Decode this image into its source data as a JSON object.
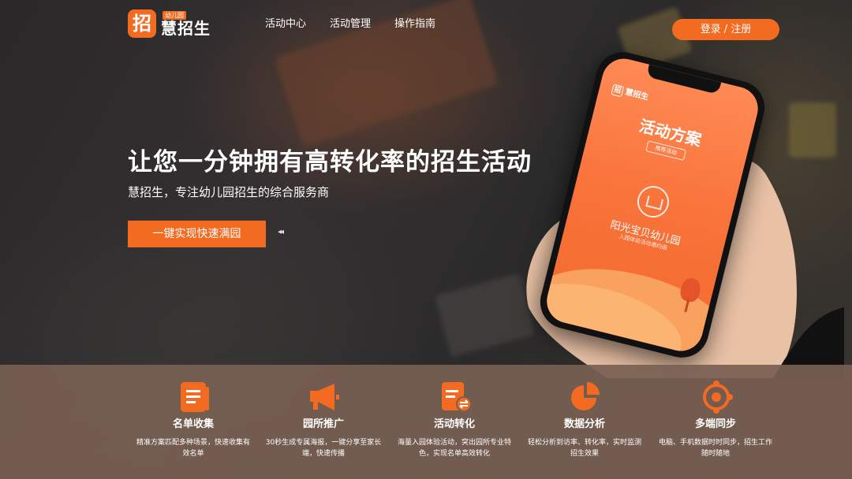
{
  "header": {
    "logo_mark": "招",
    "logo_sub": "幼儿园",
    "logo_text": "慧招生",
    "nav": [
      "活动中心",
      "活动管理",
      "操作指南"
    ],
    "login": "登录 / 注册"
  },
  "hero": {
    "headline": "让您一分钟拥有高转化率的招生活动",
    "subline": "慧招生，专注幼儿园招生的综合服务商",
    "cta": "一键实现快速满园",
    "arrows": "◂◂"
  },
  "phone": {
    "logo_mark": "招",
    "logo_text": "慧招生",
    "title": "活动方案",
    "tag": "推荐活动",
    "school": "阳光宝贝幼儿园",
    "school_sub": "入园体验活动邀约函"
  },
  "features": [
    {
      "icon": "document-list-icon",
      "title": "名单收集",
      "desc": "精准方案匹配多种场景，快速收集有效名单"
    },
    {
      "icon": "megaphone-icon",
      "title": "园所推广",
      "desc": "30秒生成专属海报，一键分享至家长端，快速传播"
    },
    {
      "icon": "conversion-icon",
      "title": "活动转化",
      "desc": "海量入园体验活动，突出园所专业特色，实现名单高效转化"
    },
    {
      "icon": "pie-chart-icon",
      "title": "数据分析",
      "desc": "轻松分析到访率、转化率，实时监测招生效果"
    },
    {
      "icon": "sync-icon",
      "title": "多端同步",
      "desc": "电脑、手机数据时时同步，招生工作随时随地"
    }
  ],
  "colors": {
    "accent": "#f26b21",
    "band": "#786052"
  }
}
